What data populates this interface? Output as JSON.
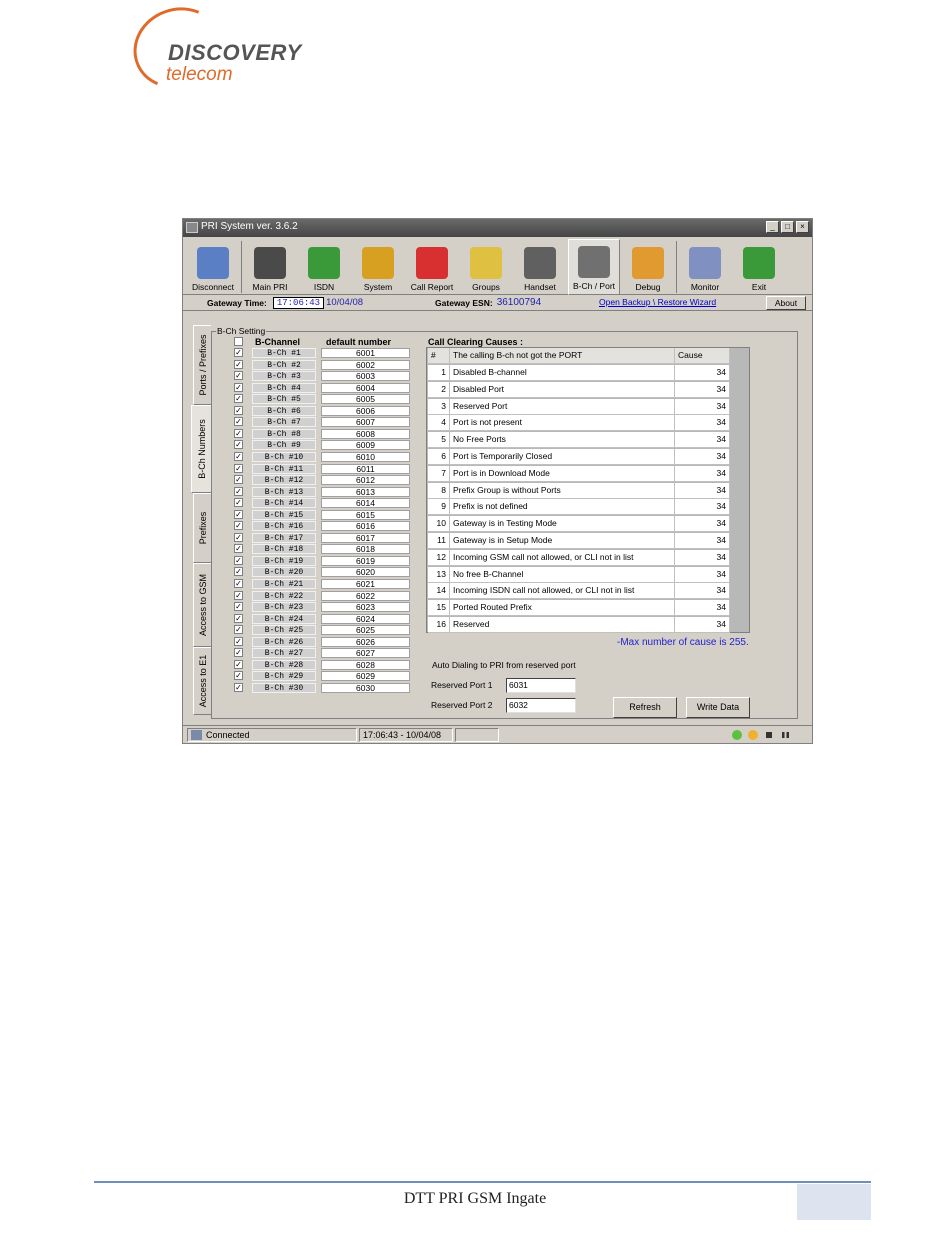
{
  "logo": {
    "line1": "DISCOVERY",
    "line2": "telecom"
  },
  "window": {
    "title": "PRI System ver. 3.6.2",
    "btn_min": "_",
    "btn_max": "□",
    "btn_close": "×"
  },
  "toolbar": [
    {
      "label": "Disconnect",
      "icon": "disconnect-icon",
      "color": "#5a7fc4"
    },
    {
      "label": "Main PRI",
      "icon": "main-pri-icon",
      "color": "#4a4a4a"
    },
    {
      "label": "ISDN",
      "icon": "isdn-card-icon",
      "color": "#3a9a3a"
    },
    {
      "label": "System",
      "icon": "tools-icon",
      "color": "#d8a020"
    },
    {
      "label": "Call Report",
      "icon": "brush-icon",
      "color": "#d83030"
    },
    {
      "label": "Groups",
      "icon": "groups-icon",
      "color": "#e0c040"
    },
    {
      "label": "Handset",
      "icon": "handset-icon",
      "color": "#606060"
    },
    {
      "label": "B-Ch / Port",
      "icon": "gear-icon",
      "color": "#707070",
      "active": true
    },
    {
      "label": "Debug",
      "icon": "debug-icon",
      "color": "#e09a30"
    },
    {
      "label": "Monitor",
      "icon": "monitor-icon",
      "color": "#8090c0"
    },
    {
      "label": "Exit",
      "icon": "exit-icon",
      "color": "#3a9a3a"
    }
  ],
  "info": {
    "time_label": "Gateway Time:",
    "time": "17:06:43",
    "date": "10/04/08",
    "esn_label": "Gateway ESN:",
    "esn": "36100794",
    "wizard": "Open Backup \\ Restore Wizard",
    "about": "About"
  },
  "tabs": [
    "Ports / Prefixes",
    "B-Ch Numbers",
    "Prefixes",
    "Access to GSM",
    "Access to E1"
  ],
  "panel": {
    "title": "B-Ch Setting",
    "col_channel": "B-Channel",
    "col_number": "default number",
    "header_check": "",
    "check_mark": "✓",
    "rows": [
      {
        "ch": "B-Ch #1",
        "num": "6001"
      },
      {
        "ch": "B-Ch #2",
        "num": "6002"
      },
      {
        "ch": "B-Ch #3",
        "num": "6003"
      },
      {
        "ch": "B-Ch #4",
        "num": "6004"
      },
      {
        "ch": "B-Ch #5",
        "num": "6005"
      },
      {
        "ch": "B-Ch #6",
        "num": "6006"
      },
      {
        "ch": "B-Ch #7",
        "num": "6007"
      },
      {
        "ch": "B-Ch #8",
        "num": "6008"
      },
      {
        "ch": "B-Ch #9",
        "num": "6009"
      },
      {
        "ch": "B-Ch #10",
        "num": "6010"
      },
      {
        "ch": "B-Ch #11",
        "num": "6011"
      },
      {
        "ch": "B-Ch #12",
        "num": "6012"
      },
      {
        "ch": "B-Ch #13",
        "num": "6013"
      },
      {
        "ch": "B-Ch #14",
        "num": "6014"
      },
      {
        "ch": "B-Ch #15",
        "num": "6015"
      },
      {
        "ch": "B-Ch #16",
        "num": "6016"
      },
      {
        "ch": "B-Ch #17",
        "num": "6017"
      },
      {
        "ch": "B-Ch #18",
        "num": "6018"
      },
      {
        "ch": "B-Ch #19",
        "num": "6019"
      },
      {
        "ch": "B-Ch #20",
        "num": "6020"
      },
      {
        "ch": "B-Ch #21",
        "num": "6021"
      },
      {
        "ch": "B-Ch #22",
        "num": "6022"
      },
      {
        "ch": "B-Ch #23",
        "num": "6023"
      },
      {
        "ch": "B-Ch #24",
        "num": "6024"
      },
      {
        "ch": "B-Ch #25",
        "num": "6025"
      },
      {
        "ch": "B-Ch #26",
        "num": "6026"
      },
      {
        "ch": "B-Ch #27",
        "num": "6027"
      },
      {
        "ch": "B-Ch #28",
        "num": "6028"
      },
      {
        "ch": "B-Ch #29",
        "num": "6029"
      },
      {
        "ch": "B-Ch #30",
        "num": "6030"
      }
    ]
  },
  "causes": {
    "title": "Call Clearing Causes :",
    "head": {
      "num": "#",
      "text": "The calling B-ch not got the PORT",
      "val": "Cause"
    },
    "rows": [
      {
        "num": "1",
        "text": "Disabled B-channel",
        "val": "34"
      },
      {
        "num": "2",
        "text": "Disabled Port",
        "val": "34"
      },
      {
        "num": "3",
        "text": "Reserved Port",
        "val": "34"
      },
      {
        "num": "4",
        "text": "Port is not present",
        "val": "34"
      },
      {
        "num": "5",
        "text": "No Free Ports",
        "val": "34"
      },
      {
        "num": "6",
        "text": "Port is Temporarily Closed",
        "val": "34"
      },
      {
        "num": "7",
        "text": "Port is in Download Mode",
        "val": "34"
      },
      {
        "num": "8",
        "text": "Prefix Group is without Ports",
        "val": "34"
      },
      {
        "num": "9",
        "text": "Prefix is not defined",
        "val": "34"
      },
      {
        "num": "10",
        "text": "Gateway is in Testing Mode",
        "val": "34"
      },
      {
        "num": "11",
        "text": "Gateway is in Setup Mode",
        "val": "34"
      },
      {
        "num": "12",
        "text": "Incoming GSM call not allowed, or CLI not in list",
        "val": "34"
      },
      {
        "num": "13",
        "text": "No free B-Channel",
        "val": "34"
      },
      {
        "num": "14",
        "text": "Incoming ISDN call not allowed, or CLI not in list",
        "val": "34"
      },
      {
        "num": "15",
        "text": "Ported Routed Prefix",
        "val": "34"
      },
      {
        "num": "16",
        "text": "Reserved",
        "val": "34"
      }
    ],
    "max_note": "-Max number of cause is 255."
  },
  "auto": {
    "title": "Auto Dialing to PRI from reserved port",
    "port1_label": "Reserved Port 1",
    "port1_value": "6031",
    "port2_label": "Reserved Port 2",
    "port2_value": "6032",
    "refresh": "Refresh",
    "write": "Write Data"
  },
  "status": {
    "connected": "Connected",
    "datetime": "17:06:43 - 10/04/08"
  },
  "footer": {
    "text": "DTT PRI GSM Ingate"
  }
}
